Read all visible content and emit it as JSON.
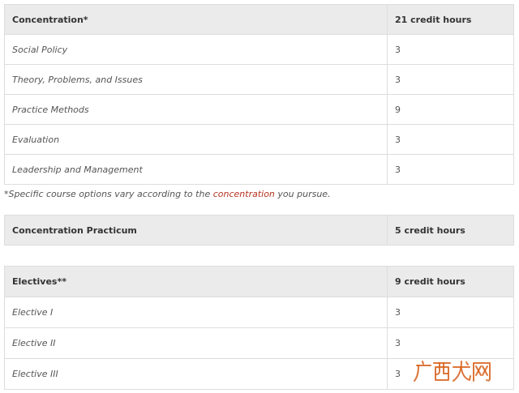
{
  "concentration": {
    "heading": "Concentration*",
    "hours": "21 credit hours",
    "rows": [
      {
        "course": "Social Policy",
        "hours": "3"
      },
      {
        "course": "Theory, Problems, and Issues",
        "hours": "3"
      },
      {
        "course": "Practice Methods",
        "hours": "9"
      },
      {
        "course": "Evaluation",
        "hours": "3"
      },
      {
        "course": "Leadership and Management",
        "hours": "3"
      }
    ]
  },
  "footnote": {
    "before": "*Specific course options vary according to the ",
    "link": "concentration",
    "after": " you pursue."
  },
  "practicum": {
    "heading": "Concentration Practicum",
    "hours": "5 credit hours"
  },
  "electives": {
    "heading": "Electives**",
    "hours": "9 credit hours",
    "rows": [
      {
        "course": "Elective I",
        "hours": "3"
      },
      {
        "course": "Elective II",
        "hours": "3"
      },
      {
        "course": "Elective III",
        "hours": "3"
      }
    ]
  },
  "watermark": {
    "text": "广西龙网",
    "color": "#d75f19"
  }
}
